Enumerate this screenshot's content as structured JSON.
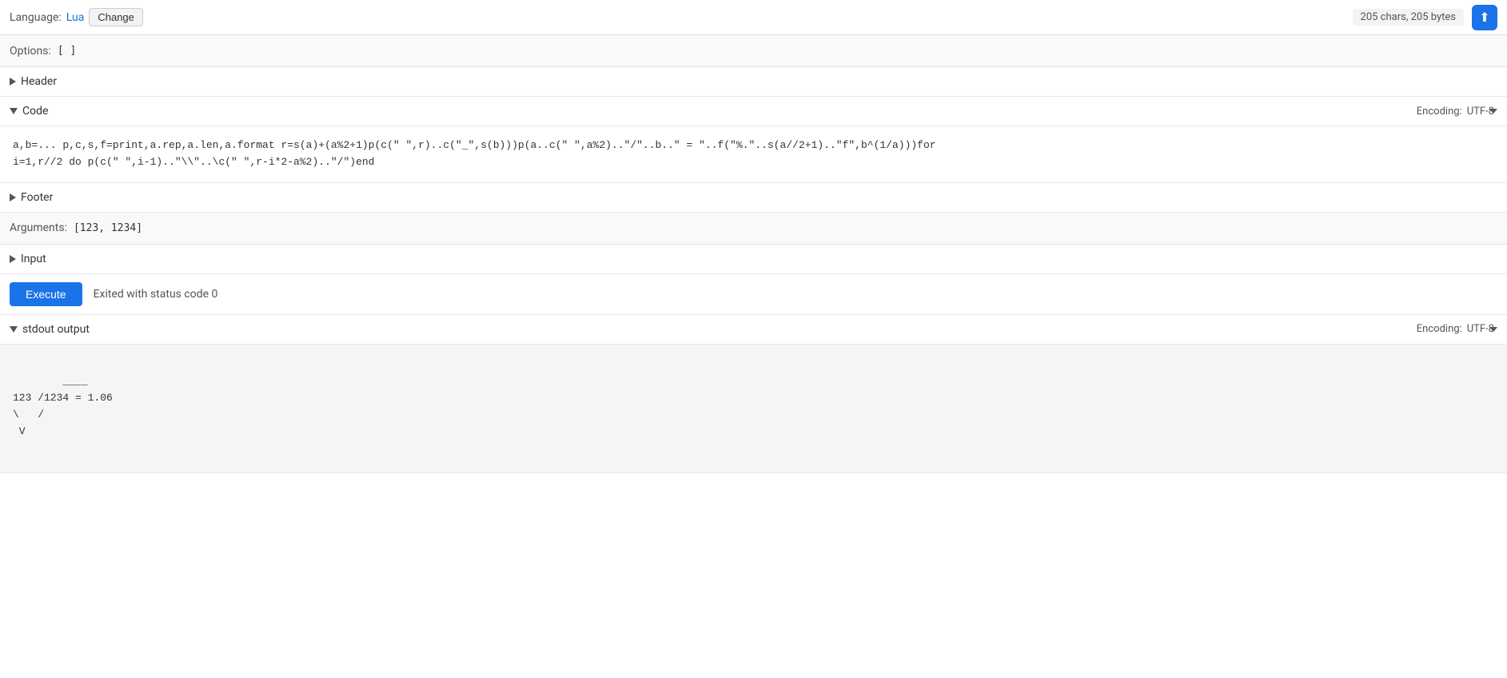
{
  "topbar": {
    "language_label": "Language:",
    "language_name": "Lua",
    "change_label": "Change",
    "chars_info": "205 chars, 205 bytes",
    "icon_symbol": "⬆"
  },
  "options": {
    "label": "Options:",
    "value": "[ ]"
  },
  "header_section": {
    "label": "Header",
    "collapsed": true
  },
  "code_section": {
    "label": "Code",
    "collapsed": false,
    "encoding_label": "Encoding:",
    "encoding_value": "UTF-8",
    "content_line1": "a,b=... p,c,s,f=print,a.rep,a.len,a.format r=s(a)+(a%2+1)p(c(\" \",r)..c(\"_\",s(b)))p(a..c(\" \",a%2)..\"/ \"..b..\" = \"..f(\"%.\"..\\ s(a//2+1)..\"f\",b^(1/a)))for",
    "content_line2": "i=1,r//2 do p(c(\" \",i-1)..\"\\\\\"..\\ c(\" \",r-i*2-a%2)..\"/\")end"
  },
  "footer_section": {
    "label": "Footer",
    "collapsed": true
  },
  "arguments": {
    "label": "Arguments:",
    "value": "[123, 1234]"
  },
  "input_section": {
    "label": "Input",
    "collapsed": true
  },
  "execute": {
    "button_label": "Execute",
    "status_text": "Exited with status code 0"
  },
  "stdout": {
    "label": "stdout output",
    "collapsed": false,
    "encoding_label": "Encoding:",
    "encoding_value": "UTF-8",
    "output_line1": "    ____",
    "output_line2": "123 /1234 = 1.06",
    "output_line3": "\\   /",
    "output_line4": " V"
  }
}
